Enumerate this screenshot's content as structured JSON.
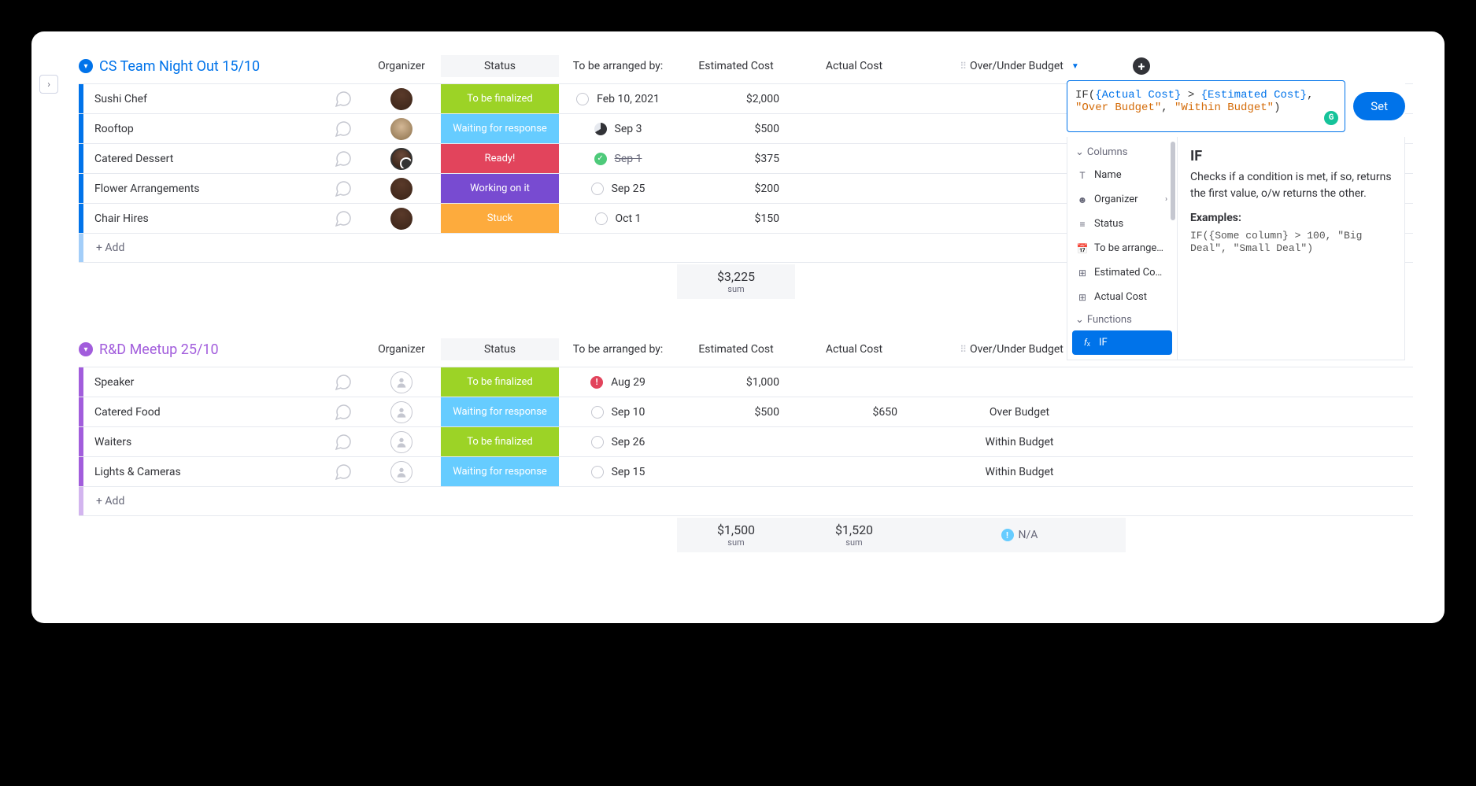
{
  "columns": {
    "organizer": "Organizer",
    "status": "Status",
    "arranged_by": "To be arranged by:",
    "est_cost": "Estimated Cost",
    "actual_cost": "Actual Cost",
    "formula": "Over/Under Budget"
  },
  "add_label": "+ Add",
  "sum_label": "sum",
  "groups": [
    {
      "id": "g1",
      "title": "CS Team Night Out 15/10",
      "color": "blue",
      "items": [
        {
          "name": "Sushi Chef",
          "avatar": "person1",
          "status": "To be finalized",
          "status_color": "green",
          "date": "Feb 10, 2021",
          "date_ind": "empty",
          "est": "$2,000",
          "actual": "",
          "budget": ""
        },
        {
          "name": "Rooftop",
          "avatar": "person2",
          "status": "Waiting for response",
          "status_color": "lightblue",
          "date": "Sep 3",
          "date_ind": "pie",
          "est": "$500",
          "actual": "",
          "budget": ""
        },
        {
          "name": "Catered Dessert",
          "avatar": "person3",
          "status": "Ready!",
          "status_color": "pink",
          "date": "Sep 1",
          "date_ind": "check",
          "date_strike": true,
          "est": "$375",
          "actual": "",
          "budget": ""
        },
        {
          "name": "Flower Arrangements",
          "avatar": "person1",
          "status": "Working on it",
          "status_color": "purple",
          "date": "Sep 25",
          "date_ind": "empty",
          "est": "$200",
          "actual": "",
          "budget": ""
        },
        {
          "name": "Chair Hires",
          "avatar": "person1",
          "status": "Stuck",
          "status_color": "orange",
          "date": "Oct 1",
          "date_ind": "empty",
          "est": "$150",
          "actual": "",
          "budget": ""
        }
      ],
      "sum_est": "$3,225",
      "sum_actual": "",
      "budget_footer": ""
    },
    {
      "id": "g2",
      "title": "R&D Meetup 25/10",
      "color": "purple",
      "items": [
        {
          "name": "Speaker",
          "avatar": "empty",
          "status": "To be finalized",
          "status_color": "green",
          "date": "Aug 29",
          "date_ind": "alert",
          "est": "$1,000",
          "actual": "",
          "budget": ""
        },
        {
          "name": "Catered Food",
          "avatar": "empty",
          "status": "Waiting for response",
          "status_color": "lightblue",
          "date": "Sep 10",
          "date_ind": "empty",
          "est": "$500",
          "actual": "$650",
          "budget": "Over Budget"
        },
        {
          "name": "Waiters",
          "avatar": "empty",
          "status": "To be finalized",
          "status_color": "green",
          "date": "Sep 26",
          "date_ind": "empty",
          "est": "",
          "actual": "",
          "budget": "Within Budget"
        },
        {
          "name": "Lights & Cameras",
          "avatar": "empty",
          "status": "Waiting for response",
          "status_color": "lightblue",
          "date": "Sep 15",
          "date_ind": "empty",
          "est": "",
          "actual": "",
          "budget": "Within Budget"
        }
      ],
      "sum_est": "$1,500",
      "sum_actual": "$1,520",
      "budget_footer": "N/A"
    }
  ],
  "formula": {
    "expression_parts": [
      {
        "t": "fn",
        "v": "IF("
      },
      {
        "t": "brace",
        "v": "{Actual Cost}"
      },
      {
        "t": "fn",
        "v": " > "
      },
      {
        "t": "brace",
        "v": "{Estimated Cost}"
      },
      {
        "t": "fn",
        "v": ", "
      },
      {
        "t": "str",
        "v": "\"Over Budget\""
      },
      {
        "t": "fn",
        "v": ", "
      },
      {
        "t": "str",
        "v": "\"Within Budget\""
      },
      {
        "t": "fn",
        "v": ")"
      }
    ],
    "set_label": "Set",
    "sections": {
      "columns_label": "Columns",
      "functions_label": "Functions"
    },
    "column_items": [
      {
        "label": "Name",
        "icon": "T"
      },
      {
        "label": "Organizer",
        "icon": "person",
        "has_submenu": true
      },
      {
        "label": "Status",
        "icon": "list"
      },
      {
        "label": "To be arrange…",
        "icon": "calendar"
      },
      {
        "label": "Estimated Co…",
        "icon": "num"
      },
      {
        "label": "Actual Cost",
        "icon": "num"
      }
    ],
    "function_items": [
      {
        "label": "IF",
        "icon": "fx",
        "active": true
      }
    ],
    "help": {
      "title": "IF",
      "desc": "Checks if a condition is met, if so, returns the first value, o/w returns the other.",
      "examples_label": "Examples:",
      "example_code": "IF({Some column} > 100, \"Big Deal\", \"Small Deal\")"
    }
  }
}
